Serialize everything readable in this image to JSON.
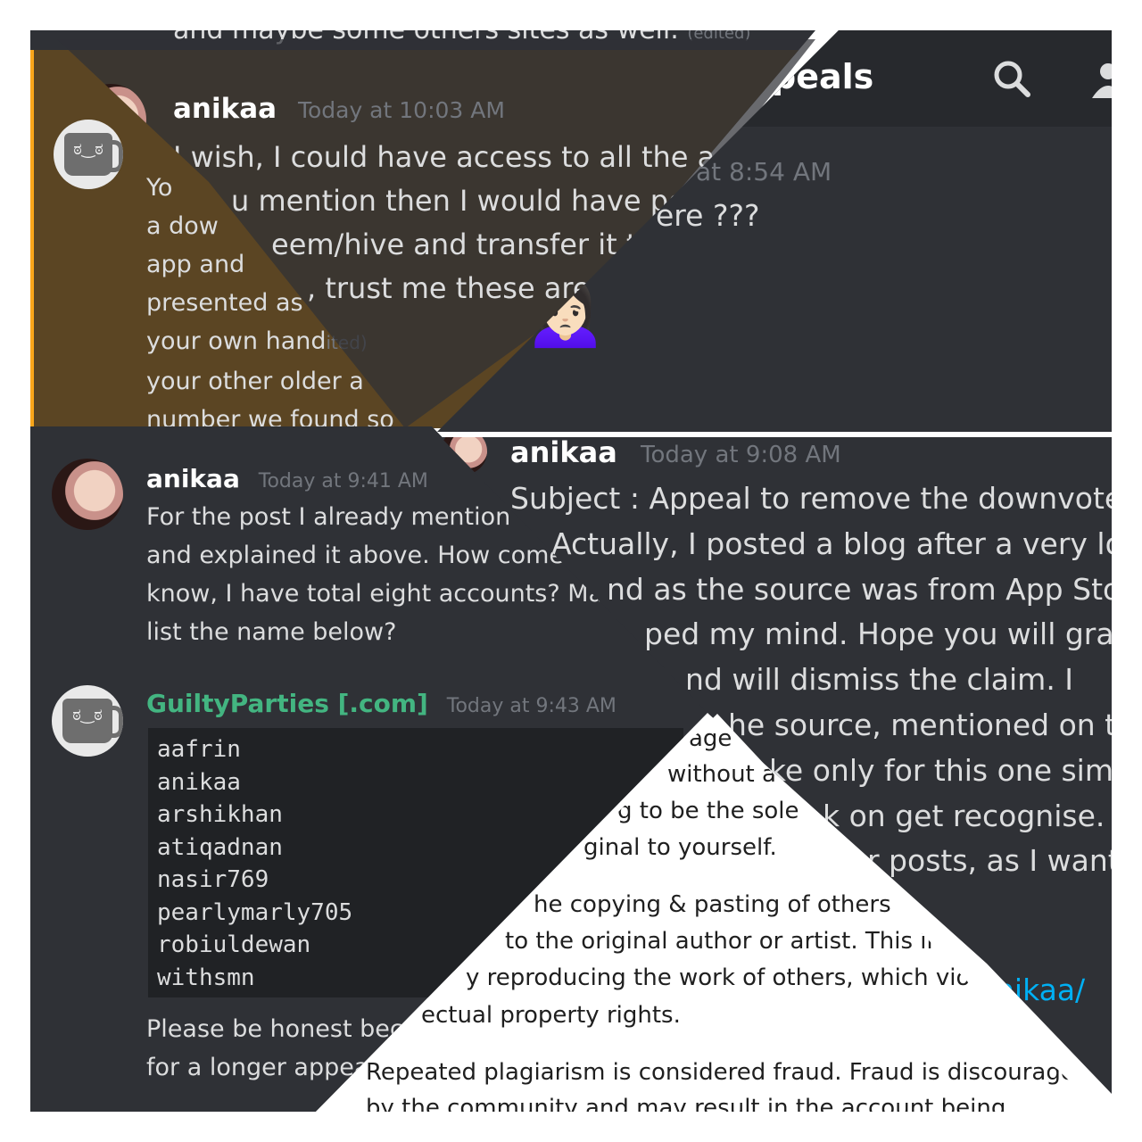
{
  "top_strip": {
    "text": "and maybe some others sites as well.",
    "edited": "(edited)"
  },
  "header": {
    "title": "peals"
  },
  "left_top": {
    "msg1": {
      "author": "anikaa",
      "time": "Today at 10:03 AM",
      "lines": [
        "I wish, I could have access to all the ac",
        "u mention then I would have pow",
        "eem/hive and transfer it to",
        ", trust me these are"
      ]
    },
    "under_lines": [
      "Yo",
      "a dow",
      "app and",
      "presented as",
      "your own hand",
      "your other older a",
      "number we found so"
    ],
    "under_edited": "ited)"
  },
  "right_top": {
    "time_fragment": "at 8:54 AM",
    "line": "ere ???",
    "emoji": "🙍🏻‍♀️"
  },
  "left_mid": {
    "msg": {
      "author": "anikaa",
      "time": "Today at 9:41 AM",
      "lines": [
        "For the post I already mention",
        "and explained it above. How come",
        "know, I have total eight accounts? Ma",
        "list the name below?"
      ]
    }
  },
  "bot_msg": {
    "author": "GuiltyParties [.com]",
    "time": "Today at 9:43 AM",
    "accounts": [
      "aafrin",
      "anikaa",
      "arshikhan",
      "atiqadnan",
      "nasir769",
      "pearlymarly705",
      "robiuldewan",
      "withsmn"
    ],
    "footer_lines": [
      "Please be honest bec",
      "for a longer appea"
    ]
  },
  "right_msg": {
    "author": "anikaa",
    "time": "Today at 9:08 AM",
    "lines": [
      "Subject : Appeal to remove the downvote.",
      "Actually, I posted a blog after a very lon",
      "nd as the source was from App Stor",
      "ped my mind. Hope you will gran",
      "nd  will dismiss the claim. I",
      "he source, mentioned on th",
      "ke only for this one simp",
      "k on get recognise.",
      "r posts, as I want"
    ],
    "link_fragment": "nikaa/"
  },
  "rules": {
    "lines": [
      "age",
      "without a",
      "g to be the sole",
      "ginal to yourself.",
      "he copying & pasting of others' w",
      "to the original author or artist. This inc",
      "y reproducing the work of others, which violate",
      "ectual property rights.",
      "Repeated plagiarism is considered fraud. Fraud is discouraged",
      "by the community and may result in the account being"
    ]
  },
  "colors": {
    "discord_bg": "#2f3136",
    "green_name": "#43b581",
    "highlight": "#5b4523",
    "highlight_bar": "#faa61a",
    "link": "#00b0f4"
  }
}
